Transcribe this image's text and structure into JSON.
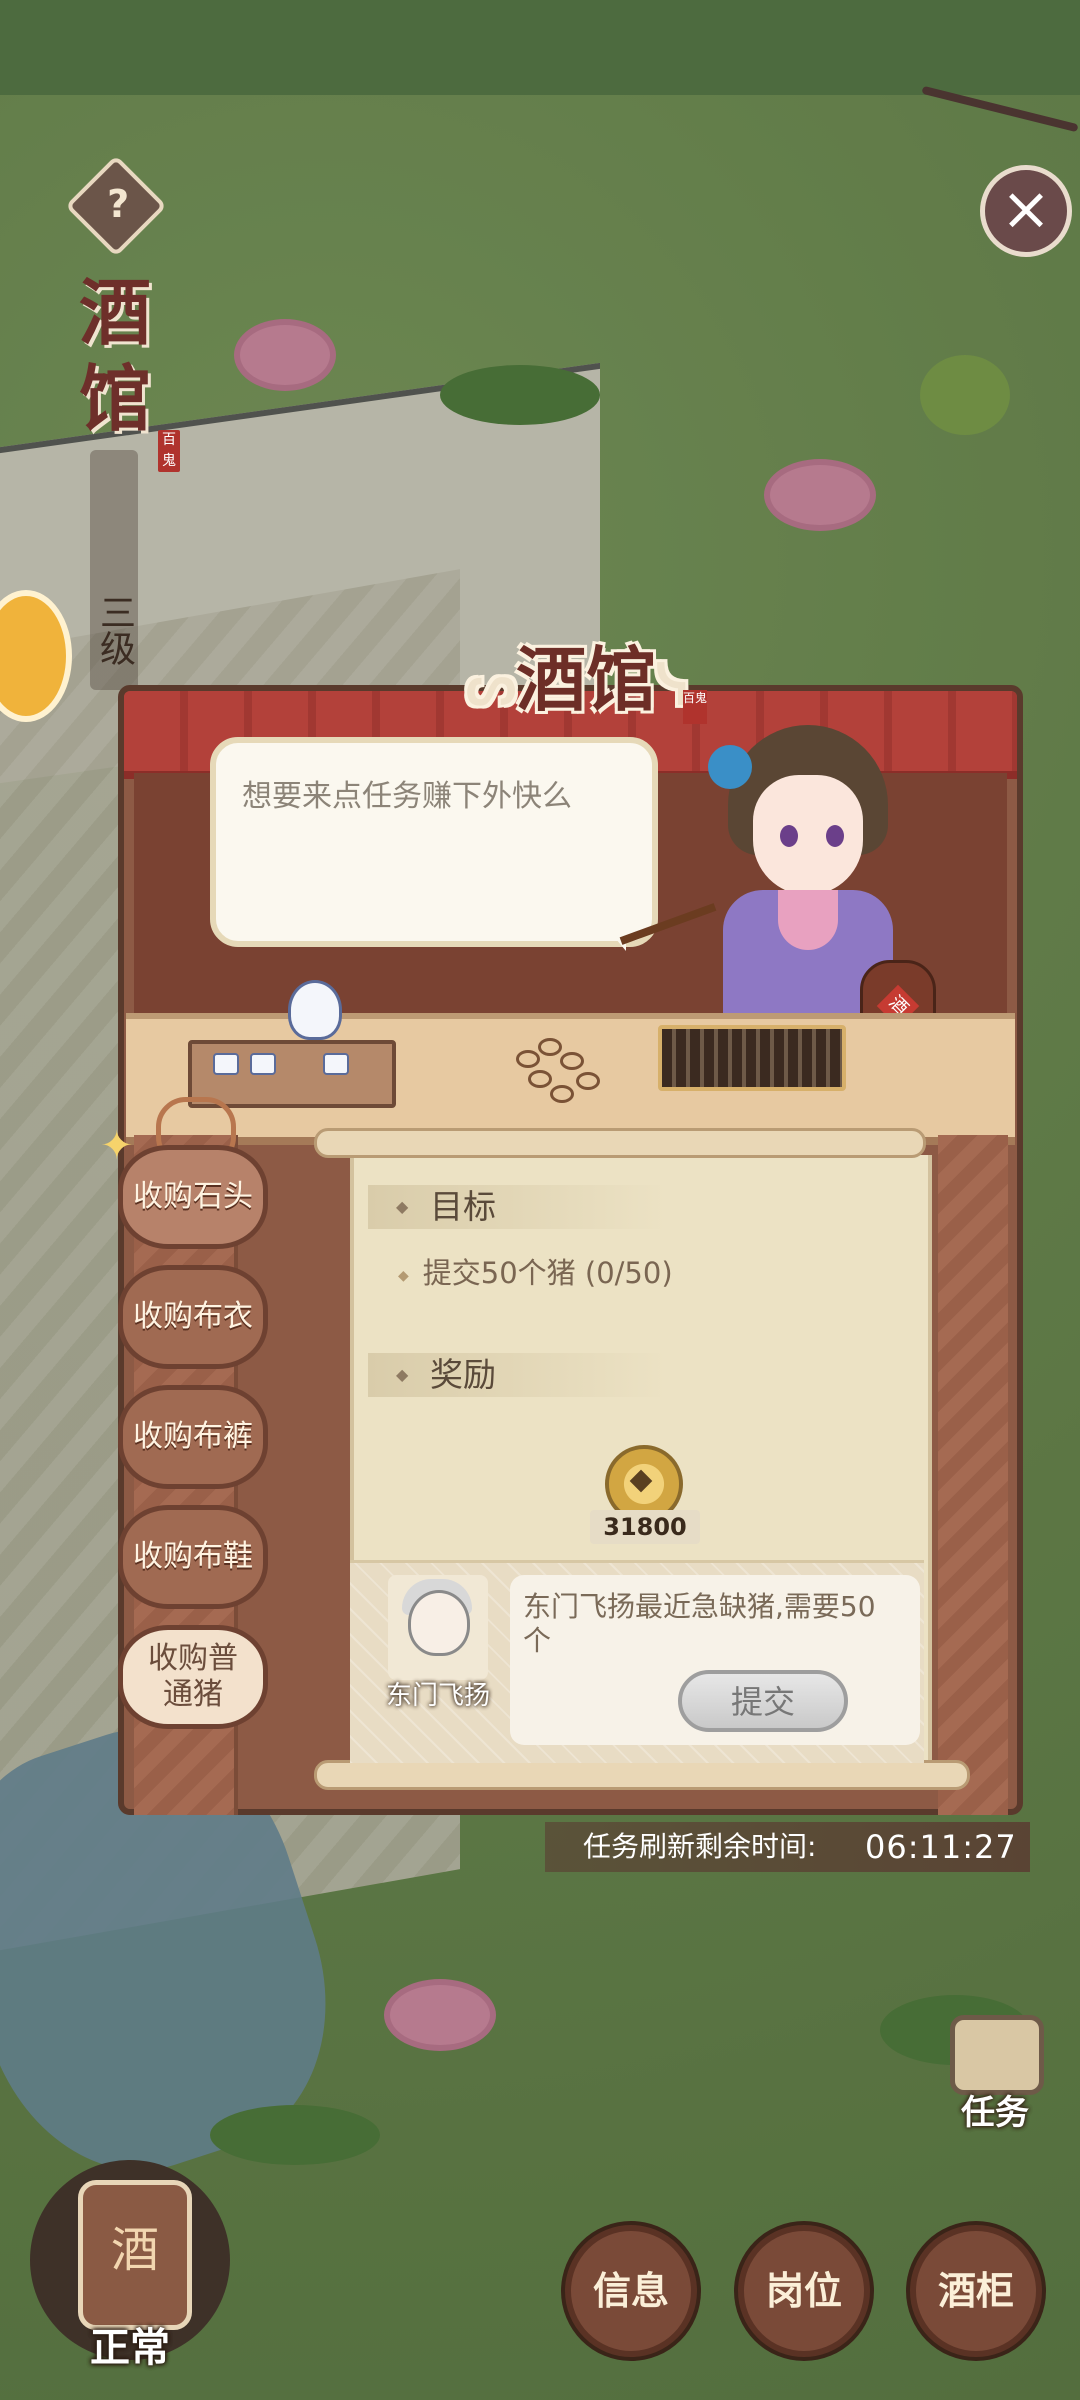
{
  "header": {
    "help_icon": "?",
    "close_icon": "×"
  },
  "sidebar": {
    "title": "酒馆",
    "level": "三级",
    "seal": "百鬼"
  },
  "modal": {
    "title": "酒馆",
    "title_seal": "百鬼",
    "speech": "想要来点任务赚下外快么",
    "jar_label": "酒",
    "tabs": [
      {
        "label": "收购石头"
      },
      {
        "label": "收购布衣"
      },
      {
        "label": "收购布裤"
      },
      {
        "label": "收购布鞋"
      },
      {
        "label": "收购普通猪"
      }
    ],
    "goal_heading": "目标",
    "goal_text": "提交50个猪 (0/50)",
    "reward_heading": "奖励",
    "reward_amount": "31800",
    "npc_name": "东门飞扬",
    "npc_message": "东门飞扬最近急缺猪,需要50个",
    "submit_label": "提交"
  },
  "refresh": {
    "label": "任务刷新剩余时间:",
    "time": "06:11:27"
  },
  "bottom": {
    "tasks_label": "任务",
    "status_icon_label": "酒",
    "status_label": "正常",
    "buttons": [
      "信息",
      "岗位",
      "酒柜"
    ]
  }
}
